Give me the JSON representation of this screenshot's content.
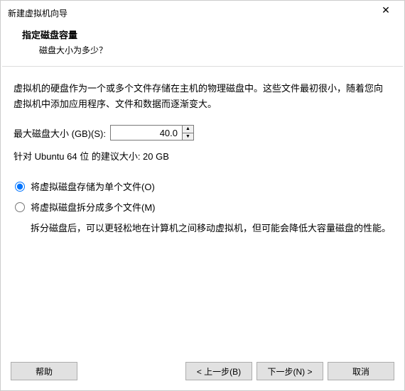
{
  "titlebar": {
    "title": "新建虚拟机向导"
  },
  "header": {
    "title": "指定磁盘容量",
    "subtitle": "磁盘大小为多少？"
  },
  "content": {
    "description": "虚拟机的硬盘作为一个或多个文件存储在主机的物理磁盘中。这些文件最初很小，随着您向虚拟机中添加应用程序、文件和数据而逐渐变大。",
    "size_label": "最大磁盘大小 (GB)(S):",
    "size_value": "40.0",
    "recommend": "针对 Ubuntu 64 位 的建议大小: 20 GB",
    "radio_single": "将虚拟磁盘存储为单个文件(O)",
    "radio_split": "将虚拟磁盘拆分成多个文件(M)",
    "split_desc": "拆分磁盘后，可以更轻松地在计算机之间移动虚拟机，但可能会降低大容量磁盘的性能。"
  },
  "footer": {
    "help": "帮助",
    "back": "< 上一步(B)",
    "next": "下一步(N) >",
    "cancel": "取消"
  }
}
